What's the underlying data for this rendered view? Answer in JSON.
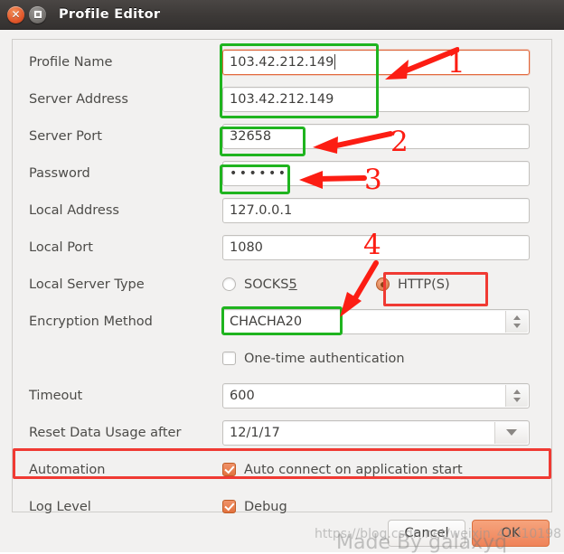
{
  "window": {
    "title": "Profile Editor",
    "close_icon": "close-icon",
    "maximize_icon": "maximize-icon"
  },
  "form": {
    "rows": [
      {
        "label": "Profile Name",
        "value": "103.42.212.149"
      },
      {
        "label": "Server Address",
        "value": "103.42.212.149"
      },
      {
        "label": "Server Port",
        "value": "32658"
      },
      {
        "label": "Password",
        "value": "••••••"
      },
      {
        "label": "Local Address",
        "value": "127.0.0.1"
      },
      {
        "label": "Local Port",
        "value": "1080"
      },
      {
        "label": "Local Server Type",
        "value": ""
      },
      {
        "label": "Encryption Method",
        "value": "CHACHA20"
      },
      {
        "label": "",
        "value": ""
      },
      {
        "label": "Timeout",
        "value": "600"
      },
      {
        "label": "Reset Data Usage after",
        "value": "12/1/17"
      },
      {
        "label": "Automation",
        "value": ""
      },
      {
        "label": "Log Level",
        "value": ""
      }
    ],
    "server_type": {
      "socks5_label": "SOCKS",
      "socks5_accel": "5",
      "socks5_selected": false,
      "https_label": "HTTP(S)",
      "https_selected": true
    },
    "one_time_auth": {
      "label": "One-time authentication",
      "checked": false
    },
    "automation": {
      "label": "Auto connect on application start",
      "checked": true
    },
    "log_level": {
      "label": "Debug",
      "checked": true
    }
  },
  "footer": {
    "cancel_label": "Cancel",
    "ok_label": "OK"
  },
  "annotations": {
    "numbers": [
      "1",
      "2",
      "3",
      "4"
    ],
    "green_color": "#1fb41f",
    "red_color": "#f03a33",
    "number_color": "#fc1d13"
  },
  "watermark": {
    "url": "https://blog.csdn.net/weixin_41010198",
    "made_by": "Made By galaxyq"
  }
}
